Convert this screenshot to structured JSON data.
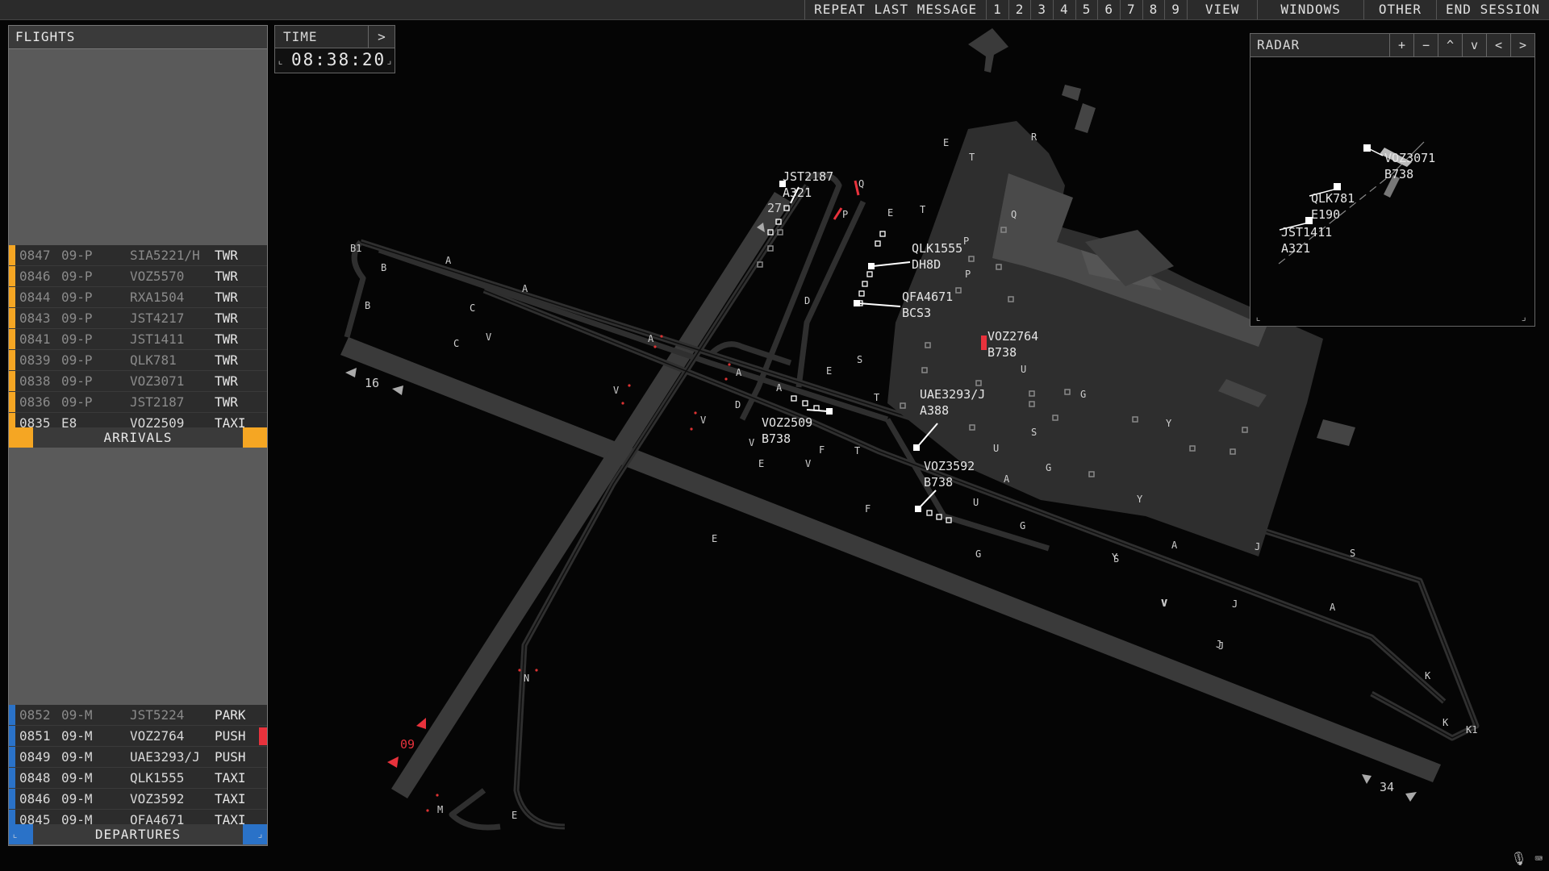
{
  "topbar": {
    "repeat_label": "REPEAT LAST MESSAGE",
    "numbers": [
      "1",
      "2",
      "3",
      "4",
      "5",
      "6",
      "7",
      "8",
      "9"
    ],
    "view_label": "VIEW",
    "windows_label": "WINDOWS",
    "other_label": "OTHER",
    "end_label": "END SESSION"
  },
  "flights": {
    "title": "FLIGHTS",
    "arrivals_label": "ARRIVALS",
    "departures_label": "DEPARTURES",
    "arrivals": [
      {
        "time": "0847",
        "rwy": "09-P",
        "callsign": "SIA5221/H",
        "status": "TWR",
        "dim": true
      },
      {
        "time": "0846",
        "rwy": "09-P",
        "callsign": "VOZ5570",
        "status": "TWR",
        "dim": true
      },
      {
        "time": "0844",
        "rwy": "09-P",
        "callsign": "RXA1504",
        "status": "TWR",
        "dim": true
      },
      {
        "time": "0843",
        "rwy": "09-P",
        "callsign": "JST4217",
        "status": "TWR",
        "dim": true
      },
      {
        "time": "0841",
        "rwy": "09-P",
        "callsign": "JST1411",
        "status": "TWR",
        "dim": true
      },
      {
        "time": "0839",
        "rwy": "09-P",
        "callsign": "QLK781",
        "status": "TWR",
        "dim": true
      },
      {
        "time": "0838",
        "rwy": "09-P",
        "callsign": "VOZ3071",
        "status": "TWR",
        "dim": true
      },
      {
        "time": "0836",
        "rwy": "09-P",
        "callsign": "JST2187",
        "status": "TWR",
        "dim": true
      },
      {
        "time": "0835",
        "rwy": "E8",
        "callsign": "VOZ2509",
        "status": "TAXI",
        "dim": false
      }
    ],
    "departures": [
      {
        "time": "0852",
        "rwy": "09-M",
        "callsign": "JST5224",
        "status": "PARK",
        "dim": true,
        "flag": false
      },
      {
        "time": "0851",
        "rwy": "09-M",
        "callsign": "VOZ2764",
        "status": "PUSH",
        "dim": false,
        "flag": true
      },
      {
        "time": "0849",
        "rwy": "09-M",
        "callsign": "UAE3293/J",
        "status": "PUSH",
        "dim": false,
        "flag": false
      },
      {
        "time": "0848",
        "rwy": "09-M",
        "callsign": "QLK1555",
        "status": "TAXI",
        "dim": false,
        "flag": false
      },
      {
        "time": "0846",
        "rwy": "09-M",
        "callsign": "VOZ3592",
        "status": "TAXI",
        "dim": false,
        "flag": false
      },
      {
        "time": "0845",
        "rwy": "09-M",
        "callsign": "QFA4671",
        "status": "TAXI",
        "dim": false,
        "flag": false
      }
    ]
  },
  "time_panel": {
    "title": "TIME",
    "arrow": ">",
    "clock": "08:38:20"
  },
  "radar": {
    "title": "RADAR",
    "buttons": [
      "+",
      "−",
      "^",
      "v",
      "<",
      ">"
    ],
    "tracks": [
      {
        "callsign": "VOZ3071",
        "type": "B738"
      },
      {
        "callsign": "QLK781",
        "type": "E190"
      },
      {
        "callsign": "JST1411",
        "type": "A321"
      }
    ]
  },
  "map": {
    "runways": [
      {
        "id": "16",
        "label": "16"
      },
      {
        "id": "34",
        "label": "34"
      },
      {
        "id": "09",
        "label": "09"
      },
      {
        "id": "27",
        "label": "27"
      }
    ],
    "taxiway_labels": [
      "B1",
      "B",
      "A",
      "A",
      "B",
      "C",
      "C",
      "V",
      "A",
      "V",
      "A",
      "V",
      "D",
      "A",
      "E",
      "S",
      "T",
      "V",
      "E",
      "V",
      "F",
      "T",
      "F",
      "E",
      "N",
      "M",
      "E",
      "P",
      "E",
      "T",
      "D",
      "P",
      "Q",
      "R",
      "E",
      "T",
      "Q",
      "P",
      "U",
      "G",
      "S",
      "U",
      "G",
      "A",
      "U",
      "G",
      "Y",
      "Y",
      "S",
      "A",
      "J",
      "J",
      "Y",
      "V",
      "J",
      "A",
      "S",
      "K",
      "K",
      "K1",
      "J",
      "G",
      "V"
    ],
    "aircraft": [
      {
        "callsign": "JST2187",
        "type": "A321"
      },
      {
        "callsign": "QLK1555",
        "type": "DH8D"
      },
      {
        "callsign": "QFA4671",
        "type": "BCS3"
      },
      {
        "callsign": "VOZ2764",
        "type": "B738"
      },
      {
        "callsign": "UAE3293/J",
        "type": "A388"
      },
      {
        "callsign": "VOZ2509",
        "type": "B738"
      },
      {
        "callsign": "VOZ3592",
        "type": "B738"
      }
    ],
    "icons": {
      "mic": "microphone-icon",
      "keyboard": "keyboard-icon"
    }
  },
  "colors": {
    "arrival": "#f5a623",
    "departure": "#2a72c8",
    "alert": "#e8323c",
    "ground": "#2e2e2e",
    "apron": "#3a3a3a"
  }
}
